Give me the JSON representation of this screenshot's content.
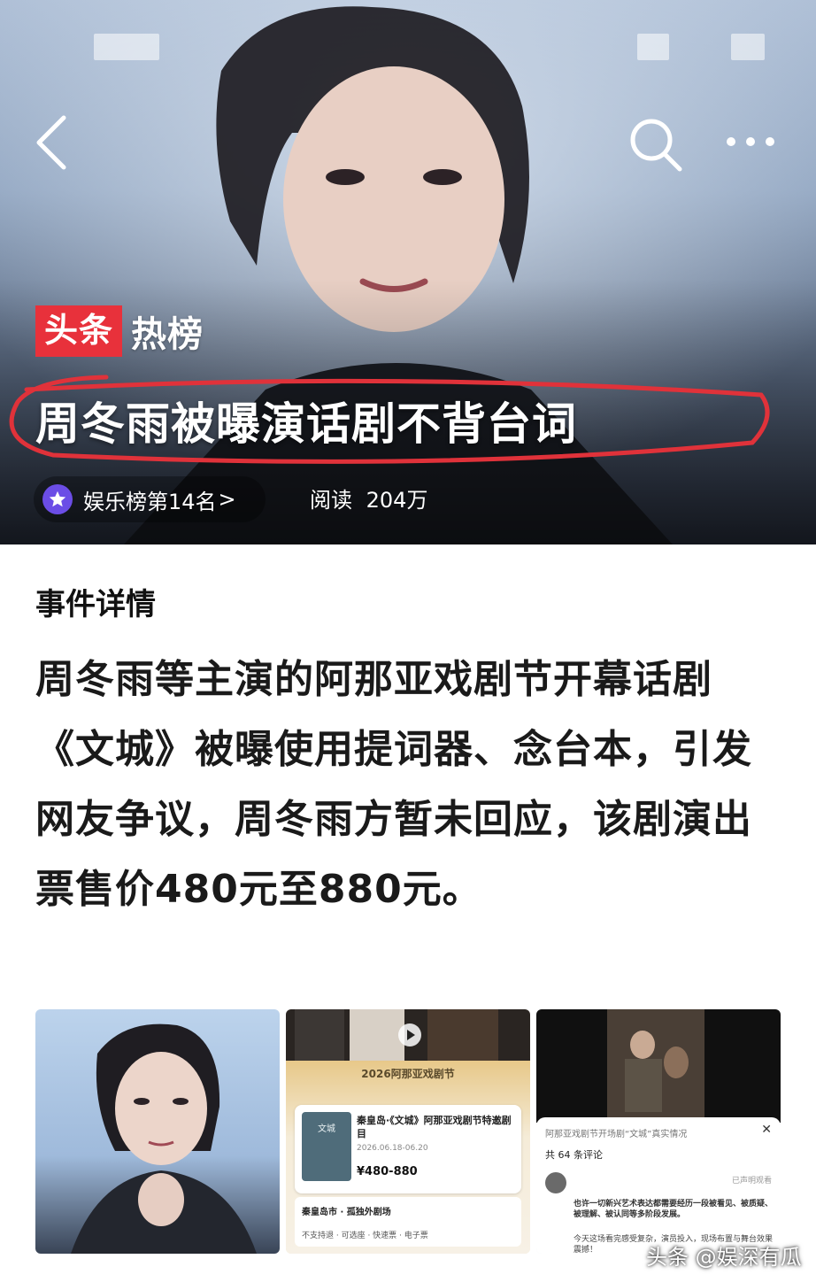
{
  "hero": {
    "brand_red": "头条",
    "brand_white": "热榜",
    "headline": "周冬雨被曝演话剧不背台词",
    "rank_label": "娱乐榜第14名",
    "rank_chevron": ">",
    "read_label": "阅读",
    "read_count": "204万"
  },
  "icons": {
    "back": "chevron-left-icon",
    "search": "search-icon",
    "more": "more-dots-icon",
    "rank": "star-icon"
  },
  "colors": {
    "brand_red": "#e8313b",
    "highlight_circle": "#e0323a",
    "rank_badge": "#6b4de6"
  },
  "event": {
    "section_title": "事件详情",
    "body": "周冬雨等主演的阿那亚戏剧节开幕话剧《文城》被曝使用提词器、念台本，引发网友争议，周冬雨方暂未回应，该剧演出票售价480元至880元。"
  },
  "thumb2": {
    "festival": "2026阿那亚戏剧节",
    "poster_text": "文城",
    "title": "秦皇岛·《文城》阿那亚戏剧节特邀剧目",
    "date": "2026.06.18-06.20",
    "price": "¥480-880",
    "venue": "秦皇岛市 · 孤独外剧场",
    "tags": "不支持退 · 可选座 · 快速票 · 电子票"
  },
  "thumb3": {
    "header": "阿那亚戏剧节开场剧“文城”真实情况",
    "comment_count": "共 64 条评论",
    "reply": "已声明观看",
    "comment_1": "也许一切新兴艺术表达都需要经历一段被看见、被质疑、被理解、被认同等多阶段发展。",
    "comment_2": "今天这场看完感受复杂，演员投入，现场布置与舞台效果震撼！"
  },
  "watermark": "头条 @娱深有瓜"
}
